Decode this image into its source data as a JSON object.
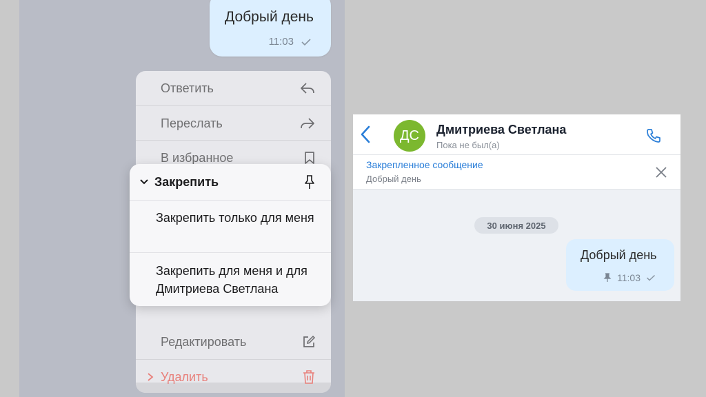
{
  "left": {
    "message": {
      "text": "Добрый день",
      "time": "11:03"
    },
    "menu": {
      "reply": "Ответить",
      "forward": "Переслать",
      "favorite": "В избранное",
      "edit": "Редактировать",
      "delete": "Удалить"
    },
    "pin_submenu": {
      "title": "Закрепить",
      "option_me": "Закрепить только для меня",
      "option_both": "Закрепить для меня и для Дмитриева Светлана"
    }
  },
  "right": {
    "contact": {
      "initials": "ДС",
      "name": "Дмитриева Светлана",
      "status": "Пока не был(а)"
    },
    "pinned": {
      "title": "Закрепленное сообщение",
      "text": "Добрый день"
    },
    "date": "30 июня 2025",
    "message": {
      "text": "Добрый день",
      "time": "11:03"
    }
  },
  "colors": {
    "bubble": "#dcefff",
    "accent": "#2a7ed8",
    "avatar": "#7cb82f",
    "delete": "#e8807b"
  }
}
